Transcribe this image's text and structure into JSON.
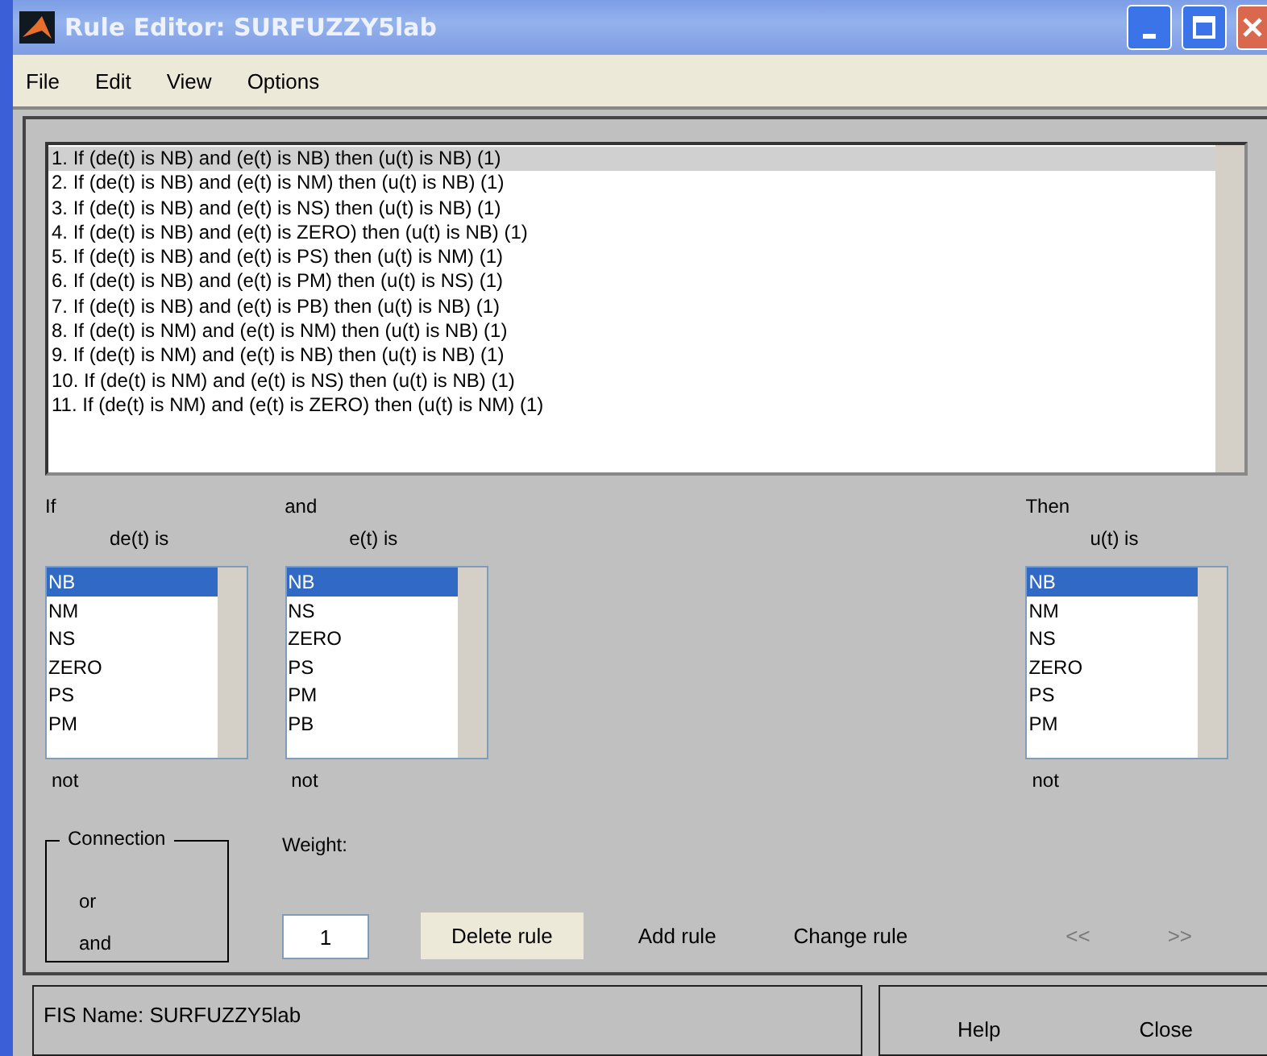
{
  "window": {
    "title": "Rule Editor: SURFUZZY5lab"
  },
  "menu": [
    "File",
    "Edit",
    "View",
    "Options"
  ],
  "rules": [
    {
      "text": "1. If (de(t) is NB) and (e(t) is NB) then (u(t) is NB) (1)",
      "selected": true
    },
    {
      "text": "2. If (de(t) is NB) and (e(t) is NM) then (u(t) is NB) (1)",
      "selected": false
    },
    {
      "text": "3. If (de(t) is NB) and (e(t) is NS) then (u(t) is NB) (1)",
      "selected": false
    },
    {
      "text": "4. If (de(t) is NB) and (e(t) is ZERO) then (u(t) is NB) (1)",
      "selected": false
    },
    {
      "text": "5. If (de(t) is NB) and (e(t) is PS) then (u(t) is NM) (1)",
      "selected": false
    },
    {
      "text": "6. If (de(t) is NB) and (e(t) is PM) then (u(t) is NS) (1)",
      "selected": false
    },
    {
      "text": "7. If (de(t) is NB) and (e(t) is PB) then (u(t) is NB) (1)",
      "selected": false
    },
    {
      "text": "8. If (de(t) is NM) and (e(t) is NM) then (u(t) is NB) (1)",
      "selected": false
    },
    {
      "text": "9. If (de(t) is NM) and (e(t) is NB) then (u(t) is NB) (1)",
      "selected": false
    },
    {
      "text": "10. If (de(t) is NM) and (e(t) is NS) then (u(t) is NB) (1)",
      "selected": false
    },
    {
      "text": "11. If (de(t) is NM) and (e(t) is ZERO) then (u(t) is NM) (1)",
      "selected": false
    }
  ],
  "variables": [
    {
      "connector": "If",
      "label": "de(t) is",
      "not": "not",
      "items": [
        {
          "text": "NB",
          "selected": true
        },
        {
          "text": "NM",
          "selected": false
        },
        {
          "text": "NS",
          "selected": false
        },
        {
          "text": "ZERO",
          "selected": false
        },
        {
          "text": "PS",
          "selected": false
        },
        {
          "text": "PM",
          "selected": false
        }
      ]
    },
    {
      "connector": "and",
      "label": "e(t) is",
      "not": "not",
      "items": [
        {
          "text": "NB",
          "selected": true
        },
        {
          "text": "NS",
          "selected": false
        },
        {
          "text": "ZERO",
          "selected": false
        },
        {
          "text": "PS",
          "selected": false
        },
        {
          "text": "PM",
          "selected": false
        },
        {
          "text": "PB",
          "selected": false
        }
      ]
    },
    {
      "connector": "Then",
      "label": "u(t) is",
      "not": "not",
      "items": [
        {
          "text": "NB",
          "selected": true
        },
        {
          "text": "NM",
          "selected": false
        },
        {
          "text": "NS",
          "selected": false
        },
        {
          "text": "ZERO",
          "selected": false
        },
        {
          "text": "PS",
          "selected": false
        },
        {
          "text": "PM",
          "selected": false
        }
      ]
    }
  ],
  "connection": {
    "title": "Connection",
    "options": [
      "or",
      "and"
    ]
  },
  "weight": {
    "label": "Weight:",
    "value": "1"
  },
  "actions": [
    {
      "label": "Delete rule",
      "disabled": false,
      "kind": "raised"
    },
    {
      "label": "Add rule",
      "disabled": false,
      "kind": "flat"
    },
    {
      "label": "Change rule",
      "disabled": false,
      "kind": "flat"
    },
    {
      "label": "<<",
      "disabled": true,
      "kind": "flat"
    },
    {
      "label": ">>",
      "disabled": true,
      "kind": "flat"
    }
  ],
  "status": "FIS Name: SURFUZZY5lab",
  "buttons": [
    "Help",
    "Close"
  ]
}
